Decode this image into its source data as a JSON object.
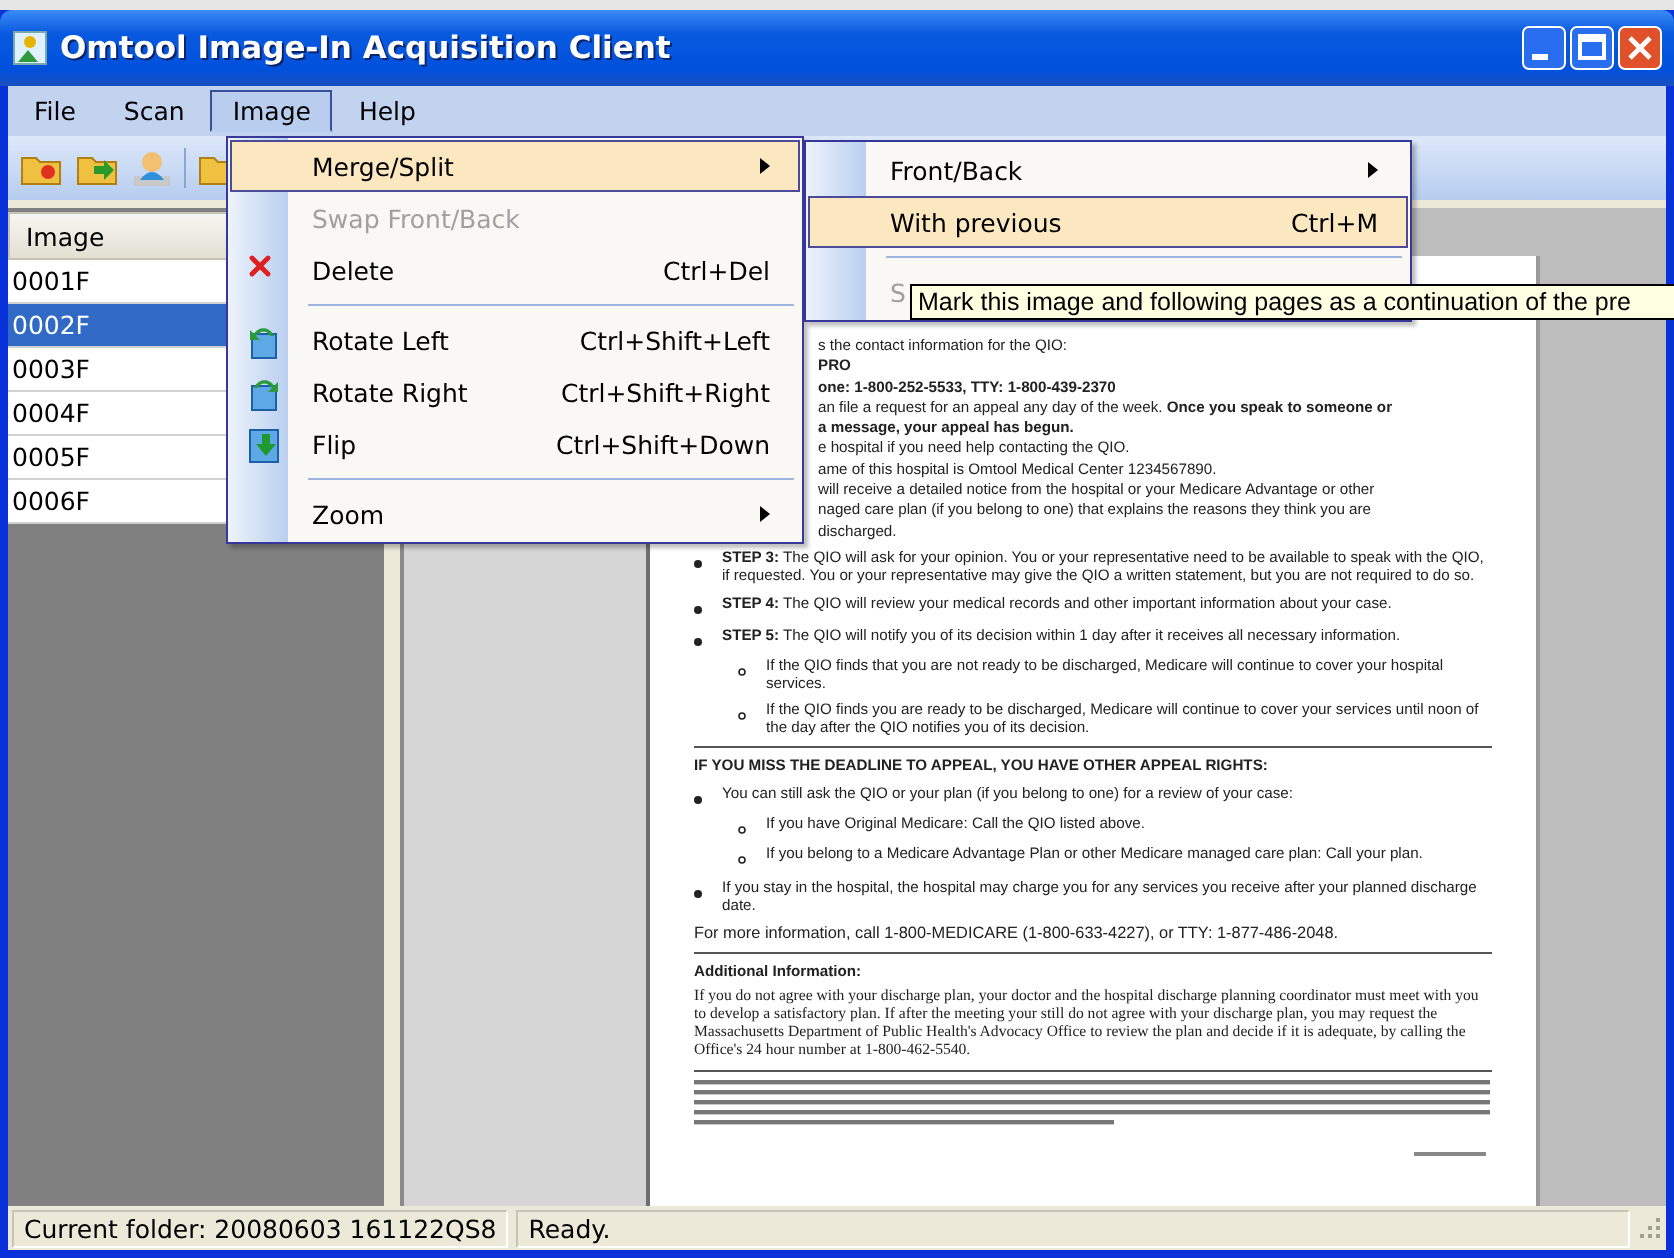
{
  "window": {
    "title": "Omtool Image-In Acquisition Client"
  },
  "menubar": [
    {
      "label": "File",
      "selected": false
    },
    {
      "label": "Scan",
      "selected": false
    },
    {
      "label": "Image",
      "selected": true
    },
    {
      "label": "Help",
      "selected": false
    }
  ],
  "image_list": {
    "column": "Image",
    "rows": [
      {
        "label": "0001F",
        "selected": false
      },
      {
        "label": "0002F",
        "selected": true
      },
      {
        "label": "0003F",
        "selected": false
      },
      {
        "label": "0004F",
        "selected": false
      },
      {
        "label": "0005F",
        "selected": false
      },
      {
        "label": "0006F",
        "selected": false
      }
    ]
  },
  "image_menu": {
    "items": [
      {
        "kind": "item",
        "label": "Merge/Split",
        "submenu": true,
        "selected": true,
        "disabled": false
      },
      {
        "kind": "item",
        "label": "Swap Front/Back",
        "submenu": false,
        "selected": false,
        "disabled": true
      },
      {
        "kind": "item",
        "label": "Delete",
        "shortcut": "Ctrl+Del",
        "submenu": false,
        "selected": false,
        "disabled": false
      },
      {
        "kind": "separator"
      },
      {
        "kind": "item",
        "label": "Rotate Left",
        "shortcut": "Ctrl+Shift+Left",
        "submenu": false,
        "selected": false,
        "disabled": false
      },
      {
        "kind": "item",
        "label": "Rotate Right",
        "shortcut": "Ctrl+Shift+Right",
        "submenu": false,
        "selected": false,
        "disabled": false
      },
      {
        "kind": "item",
        "label": "Flip",
        "shortcut": "Ctrl+Shift+Down",
        "submenu": false,
        "selected": false,
        "disabled": false
      },
      {
        "kind": "separator"
      },
      {
        "kind": "item",
        "label": "Zoom",
        "submenu": true,
        "selected": false,
        "disabled": false
      }
    ]
  },
  "merge_split_menu": {
    "items": [
      {
        "kind": "item",
        "label": "Front/Back",
        "submenu": true,
        "selected": false,
        "disabled": false
      },
      {
        "kind": "item",
        "label": "With previous",
        "shortcut": "Ctrl+M",
        "submenu": false,
        "selected": true,
        "disabled": false
      },
      {
        "kind": "separator"
      },
      {
        "kind": "item",
        "label": "S",
        "submenu": false,
        "selected": false,
        "disabled": true
      }
    ]
  },
  "tooltip": "Mark this image and following pages as a continuation of the pre",
  "document": {
    "lines": [
      {
        "kind": "fragment",
        "text": "s the contact information for the QIO:"
      },
      {
        "kind": "fragment",
        "text": "**PRO**"
      },
      {
        "kind": "fragment",
        "text": "**one: 1-800-252-5533,  TTY: 1-800-439-2370**"
      },
      {
        "kind": "fragment",
        "text": "an file a request for an appeal any day of the week. **Once you speak to someone or**"
      },
      {
        "kind": "fragment",
        "text": "**a message, your appeal has begun.**"
      },
      {
        "kind": "fragment",
        "text": "e hospital if you need help contacting the QIO."
      },
      {
        "kind": "fragment",
        "text": "ame of this hospital is Omtool Medical Center   1234567890."
      },
      {
        "kind": "fragment",
        "text": "will receive a detailed notice from the hospital or your Medicare Advantage or other"
      },
      {
        "kind": "fragment",
        "text": "naged care plan (if you belong to one) that explains the reasons they think you are"
      },
      {
        "kind": "fragment",
        "text": "discharged."
      },
      {
        "kind": "bullet",
        "text": "**STEP 3:** The QIO will ask for your opinion. You or your representative need to be available to speak with the QIO, if requested. You or your representative may give the QIO a written statement, but you are not required to do so."
      },
      {
        "kind": "bullet",
        "text": "**STEP 4:** The QIO will review your medical records and other important information about your case."
      },
      {
        "kind": "bullet",
        "text": "**STEP 5:** The QIO will notify you of its decision within 1 day after it receives all necessary information."
      },
      {
        "kind": "subbullet",
        "text": "If the QIO finds that you are not ready to be discharged, Medicare will continue to cover your hospital services."
      },
      {
        "kind": "subbullet",
        "text": "If the QIO finds you are ready to be discharged, Medicare will continue to cover your services until noon of the day after the QIO notifies you of its decision."
      },
      {
        "kind": "rule"
      },
      {
        "kind": "heading",
        "text": "IF YOU MISS THE DEADLINE TO APPEAL, YOU HAVE OTHER APPEAL RIGHTS:"
      },
      {
        "kind": "bullet",
        "text": "You can still ask the QIO or your plan (if you belong to one) for a review of your case:"
      },
      {
        "kind": "subbullet",
        "text": "If you have Original Medicare: Call the QIO listed above."
      },
      {
        "kind": "subbullet",
        "text": "If you belong to a Medicare Advantage Plan or other Medicare managed care plan: Call your plan."
      },
      {
        "kind": "bullet",
        "text": "If you stay in the hospital, the hospital may charge you for any services you receive after your planned discharge date."
      },
      {
        "kind": "para",
        "text": "For more information, call 1-800-MEDICARE (1-800-633-4227), or TTY: 1-877-486-2048."
      },
      {
        "kind": "rule"
      },
      {
        "kind": "heading",
        "text": "Additional Information:"
      },
      {
        "kind": "serif",
        "text": "If you do not agree with your discharge plan, your doctor and the hospital discharge planning coordinator must meet with you to develop a satisfactory plan.  If after the meeting your still do not agree with your discharge plan, you may request the Massachusetts Department of Public Health's Advocacy Office to review the plan and decide if it is adequate, by calling the Office's 24 hour number at 1-800-462-5540."
      },
      {
        "kind": "rule"
      },
      {
        "kind": "fineprint"
      }
    ]
  },
  "status_bar": {
    "folder": "Current folder: 20080603 161122QS8",
    "status": "Ready."
  }
}
